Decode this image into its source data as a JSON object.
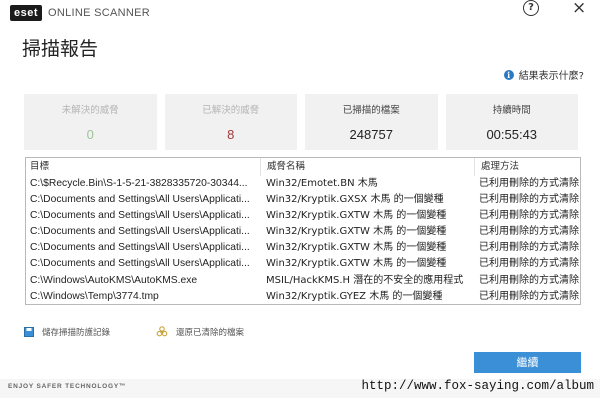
{
  "app": {
    "logo_mark": "eset",
    "product_name": "ONLINE SCANNER",
    "help_symbol": "?",
    "close_symbol": "×"
  },
  "page": {
    "title": "掃描報告",
    "info_link": "結果表示什麼?"
  },
  "stats": [
    {
      "label": "未解決的威脅",
      "value": "0"
    },
    {
      "label": "已解決的威脅",
      "value": "8"
    },
    {
      "label": "已掃描的檔案",
      "value": "248757"
    },
    {
      "label": "持續時間",
      "value": "00:55:43"
    }
  ],
  "table": {
    "columns": [
      "目標",
      "威脅名稱",
      "處理方法"
    ],
    "rows": [
      [
        "C:\\$Recycle.Bin\\S-1-5-21-3828335720-30344...",
        "Win32/Emotet.BN 木馬",
        "已利用刪除的方式清除"
      ],
      [
        "C:\\Documents and Settings\\All Users\\Applicati...",
        "Win32/Kryptik.GXSX 木馬 的一個變種",
        "已利用刪除的方式清除"
      ],
      [
        "C:\\Documents and Settings\\All Users\\Applicati...",
        "Win32/Kryptik.GXTW 木馬 的一個變種",
        "已利用刪除的方式清除"
      ],
      [
        "C:\\Documents and Settings\\All Users\\Applicati...",
        "Win32/Kryptik.GXTW 木馬 的一個變種",
        "已利用刪除的方式清除"
      ],
      [
        "C:\\Documents and Settings\\All Users\\Applicati...",
        "Win32/Kryptik.GXTW 木馬 的一個變種",
        "已利用刪除的方式清除"
      ],
      [
        "C:\\Documents and Settings\\All Users\\Applicati...",
        "Win32/Kryptik.GXTW 木馬 的一個變種",
        "已利用刪除的方式清除"
      ],
      [
        "C:\\Windows\\AutoKMS\\AutoKMS.exe",
        "MSIL/HackKMS.H 潛在的不安全的應用程式",
        "已利用刪除的方式清除"
      ],
      [
        "C:\\Windows\\Temp\\3774.tmp",
        "Win32/Kryptik.GYEZ 木馬 的一個變種",
        "已利用刪除的方式清除"
      ]
    ]
  },
  "actions": {
    "save_log": "儲存掃描防護記錄",
    "restore": "還原已清除的檔案",
    "continue": "繼續"
  },
  "footer": {
    "tagline": "ENJOY SAFER TECHNOLOGY™",
    "watermark": "http://www.fox-saying.com/album"
  },
  "colors": {
    "accent": "#3a8fd6",
    "unresolved": "#9dc59a",
    "resolved": "#a03b3b"
  }
}
